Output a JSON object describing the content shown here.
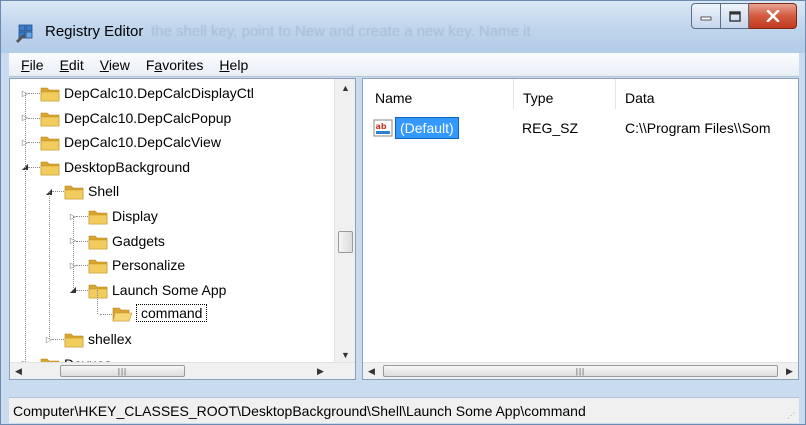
{
  "window": {
    "title": "Registry Editor",
    "ghost_title": "the shell key, point to New and create a new key. Name it"
  },
  "menu": [
    {
      "label": "File",
      "key": "F",
      "rest": "ile"
    },
    {
      "label": "Edit",
      "key": "E",
      "rest": "dit"
    },
    {
      "label": "View",
      "key": "V",
      "rest": "iew"
    },
    {
      "label": "Favorites",
      "key": "a",
      "pre": "F",
      "rest": "vorites"
    },
    {
      "label": "Help",
      "key": "H",
      "rest": "elp"
    }
  ],
  "tree": {
    "items": [
      {
        "label": "DepCalc10.DepCalcDisplayCtl",
        "level": 0,
        "expander": "closed"
      },
      {
        "label": "DepCalc10.DepCalcPopup",
        "level": 0,
        "expander": "closed"
      },
      {
        "label": "DepCalc10.DepCalcView",
        "level": 0,
        "expander": "closed"
      },
      {
        "label": "DesktopBackground",
        "level": 0,
        "expander": "open"
      },
      {
        "label": "Shell",
        "level": 1,
        "expander": "open"
      },
      {
        "label": "Display",
        "level": 2,
        "expander": "closed"
      },
      {
        "label": "Gadgets",
        "level": 2,
        "expander": "closed"
      },
      {
        "label": "Personalize",
        "level": 2,
        "expander": "closed"
      },
      {
        "label": "Launch Some App",
        "level": 2,
        "expander": "open"
      },
      {
        "label": "command",
        "level": 3,
        "expander": "none",
        "selected": true
      },
      {
        "label": "shellex",
        "level": 1,
        "expander": "closed"
      },
      {
        "label": "Devues",
        "level": 0,
        "expander": "closed"
      }
    ]
  },
  "list": {
    "columns": [
      "Name",
      "Type",
      "Data"
    ],
    "rows": [
      {
        "name": "(Default)",
        "type": "REG_SZ",
        "data": "C:\\\\Program Files\\\\Som"
      }
    ]
  },
  "status": {
    "path": "Computer\\HKEY_CLASSES_ROOT\\DesktopBackground\\Shell\\Launch Some App\\command"
  },
  "colors": {
    "selection": "#3399ff",
    "folder": "#e8b93c",
    "title_bar": "#c3d7ee"
  }
}
